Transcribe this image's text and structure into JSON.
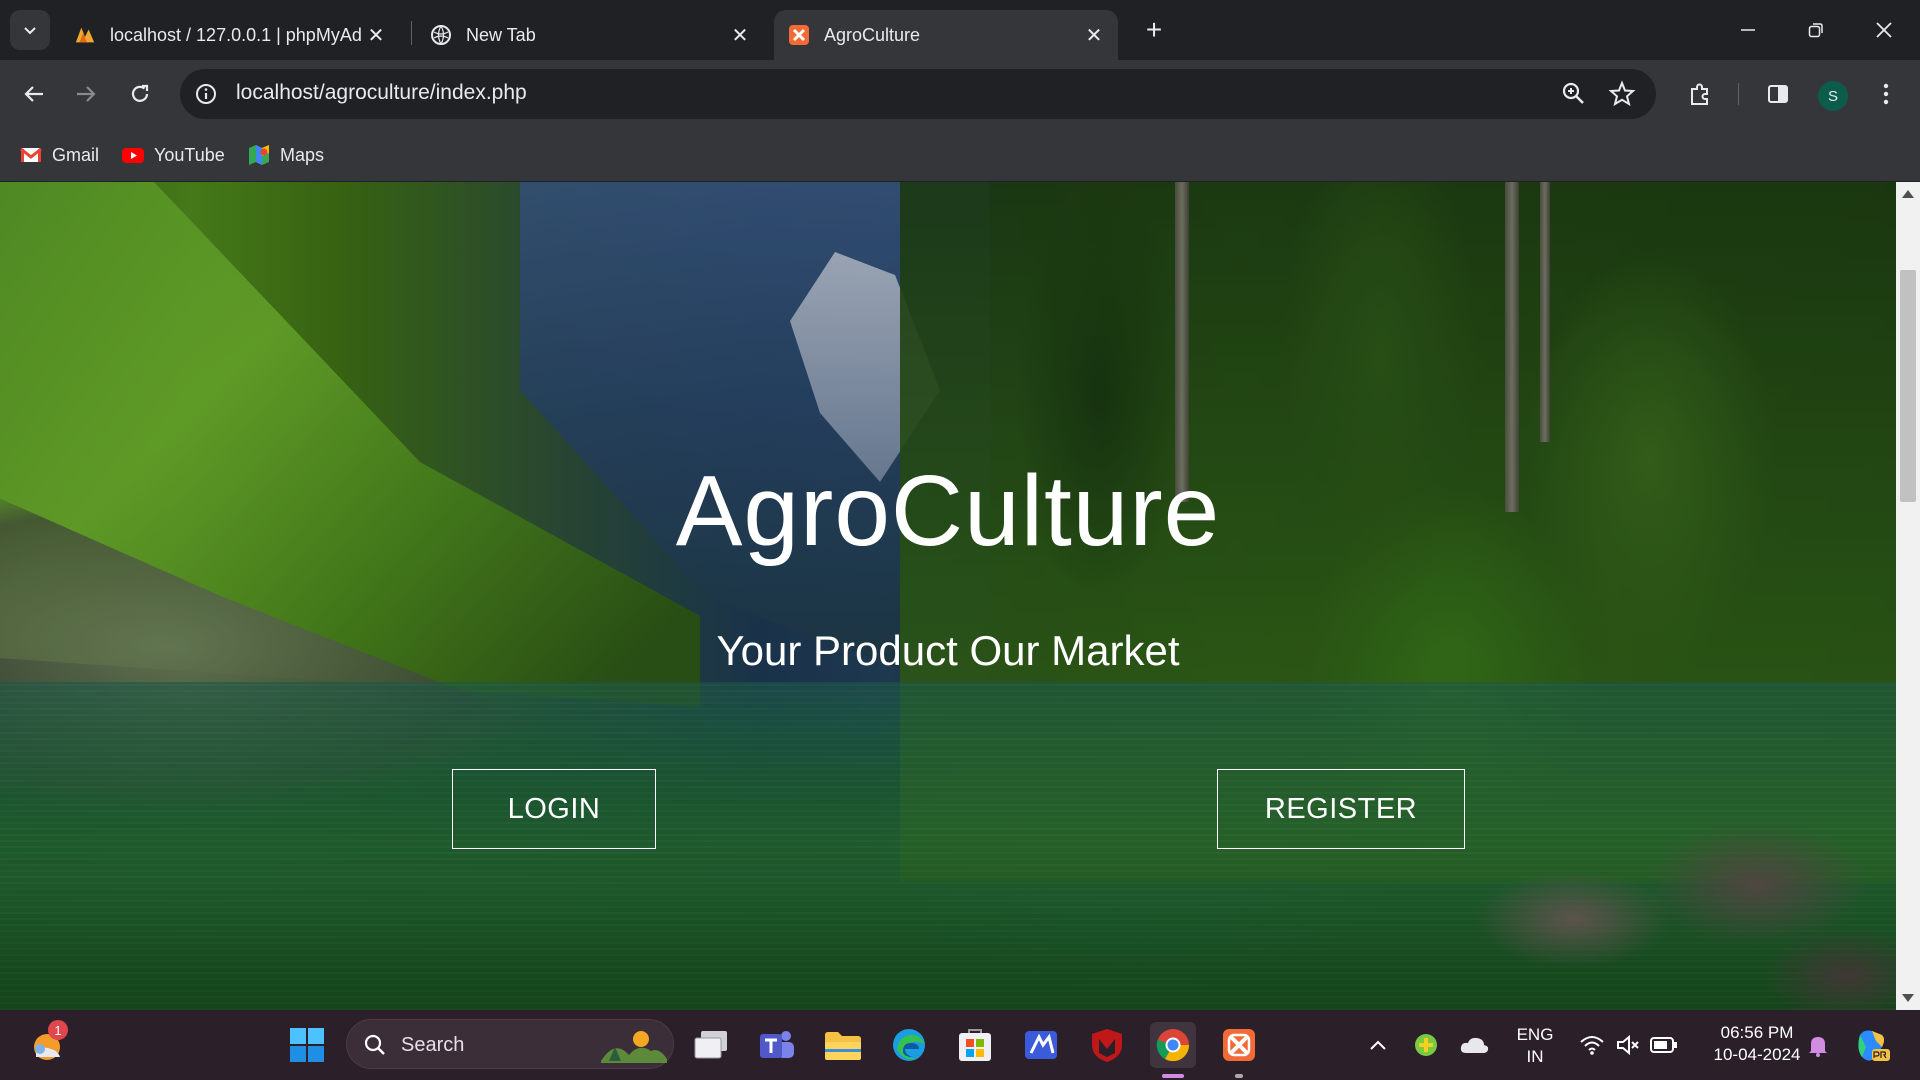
{
  "browser": {
    "tabs": [
      {
        "title": "localhost / 127.0.0.1 | phpMyAd",
        "favicon": "phpmyadmin-icon",
        "active": false
      },
      {
        "title": "New Tab",
        "favicon": "globe-icon",
        "active": false
      },
      {
        "title": "AgroCulture",
        "favicon": "xampp-icon",
        "active": true
      }
    ],
    "address": "localhost/agroculture/index.php",
    "profile_initial": "S",
    "bookmarks": [
      {
        "label": "Gmail",
        "icon": "gmail-icon"
      },
      {
        "label": "YouTube",
        "icon": "youtube-icon"
      },
      {
        "label": "Maps",
        "icon": "maps-icon"
      }
    ]
  },
  "page": {
    "title": "AgroCulture",
    "subtitle": "Your Product Our Market",
    "login_label": "LOGIN",
    "register_label": "REGISTER"
  },
  "taskbar": {
    "search_label": "Search",
    "widget_badge": "1",
    "language": {
      "line1": "ENG",
      "line2": "IN"
    },
    "time": "06:56 PM",
    "date": "10-04-2024"
  },
  "colors": {
    "chrome_dark": "#202124",
    "chrome_toolbar": "#35363a",
    "taskbar": "#2b1f2a",
    "accent_orange": "#f26b36"
  }
}
